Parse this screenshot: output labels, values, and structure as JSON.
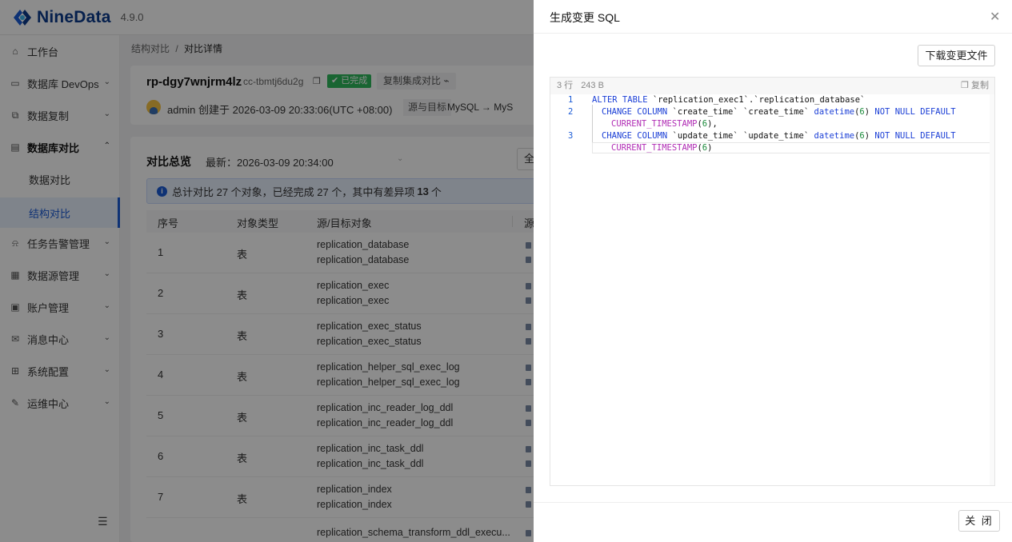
{
  "app": {
    "name": "NineData",
    "version": "4.9.0"
  },
  "sidebar": {
    "items": [
      {
        "label": "工作台",
        "icon": "home-icon"
      },
      {
        "label": "数据库 DevOps",
        "icon": "monitor-icon",
        "chevron": "down"
      },
      {
        "label": "数据复制",
        "icon": "copy-icon",
        "chevron": "down"
      },
      {
        "label": "数据库对比",
        "icon": "compare-icon",
        "chevron": "up",
        "expanded": true
      },
      {
        "label": "任务告警管理",
        "icon": "alarm-icon",
        "chevron": "down"
      },
      {
        "label": "数据源管理",
        "icon": "datasource-icon",
        "chevron": "down"
      },
      {
        "label": "账户管理",
        "icon": "account-icon",
        "chevron": "down"
      },
      {
        "label": "消息中心",
        "icon": "mail-icon",
        "chevron": "down"
      },
      {
        "label": "系统配置",
        "icon": "grid-icon",
        "chevron": "down"
      },
      {
        "label": "运维中心",
        "icon": "wrench-icon",
        "chevron": "down"
      }
    ],
    "sub_items": [
      {
        "label": "数据对比",
        "active": false
      },
      {
        "label": "结构对比",
        "active": true
      }
    ]
  },
  "breadcrumb": {
    "parent": "结构对比",
    "separator": "/",
    "current": "对比详情"
  },
  "task": {
    "name": "rp-dgy7wnjrm4lz",
    "id": "cc-tbmtj6du2g",
    "status": "已完成",
    "merge_label": "复制集成对比",
    "creator_text": "admin 创建于 2026-03-09 20:33:06(UTC +08:00)",
    "src_dst_label": "源与目标",
    "src_dst_value": "MySQL → MyS"
  },
  "overview": {
    "title": "对比总览",
    "latest": "最新：2026-03-09 20:34:00",
    "filter": "全",
    "summary_prefix": "总计对比 27 个对象，已经完成 27 个，其中有差异项",
    "summary_count": "13",
    "summary_suffix": "个"
  },
  "table": {
    "headers": {
      "no": "序号",
      "type": "对象类型",
      "object": "源/目标对象",
      "extra": "源"
    },
    "rows": [
      {
        "no": "1",
        "type": "表",
        "src": "replication_database",
        "dst": "replication_database"
      },
      {
        "no": "2",
        "type": "表",
        "src": "replication_exec",
        "dst": "replication_exec"
      },
      {
        "no": "3",
        "type": "表",
        "src": "replication_exec_status",
        "dst": "replication_exec_status"
      },
      {
        "no": "4",
        "type": "表",
        "src": "replication_helper_sql_exec_log",
        "dst": "replication_helper_sql_exec_log"
      },
      {
        "no": "5",
        "type": "表",
        "src": "replication_inc_reader_log_ddl",
        "dst": "replication_inc_reader_log_ddl"
      },
      {
        "no": "6",
        "type": "表",
        "src": "replication_inc_task_ddl",
        "dst": "replication_inc_task_ddl"
      },
      {
        "no": "7",
        "type": "表",
        "src": "replication_index",
        "dst": "replication_index"
      },
      {
        "no": "",
        "type": "",
        "src": "replication_schema_transform_ddl_execu...",
        "dst": ""
      }
    ]
  },
  "drawer": {
    "title": "生成变更 SQL",
    "download_label": "下载变更文件",
    "meta_lines": "3 行",
    "meta_size": "243 B",
    "copy_label": "复制",
    "close_label": "关 闭",
    "code": {
      "l1_no": "1",
      "l1_kw1": "ALTER TABLE",
      "l1_rest": " `replication_exec1`.`replication_database`",
      "l2_no": "2",
      "l2_kw1": "CHANGE COLUMN",
      "l2_rest": " `create_time` `create_time` ",
      "l2_type": "datetime",
      "l2_p1": "(",
      "l2_num": "6",
      "l2_p2": ") ",
      "l2_kw2": "NOT NULL DEFAULT",
      "l2b_fn": "CURRENT_TIMESTAMP",
      "l2b_p1": "(",
      "l2b_num": "6",
      "l2b_p2": "),",
      "l3_no": "3",
      "l3_kw1": "CHANGE COLUMN",
      "l3_rest": " `update_time` `update_time` ",
      "l3_type": "datetime",
      "l3_p1": "(",
      "l3_num": "6",
      "l3_p2": ") ",
      "l3_kw2": "NOT NULL DEFAULT",
      "l3b_fn": "CURRENT_TIMESTAMP",
      "l3b_p1": "(",
      "l3b_num": "6",
      "l3b_p2": ")"
    }
  },
  "colors": {
    "brand": "#0b3b8c",
    "accent": "#1b5bd6",
    "success": "#2eb85c",
    "mask": "rgba(0,0,0,0.45)"
  }
}
